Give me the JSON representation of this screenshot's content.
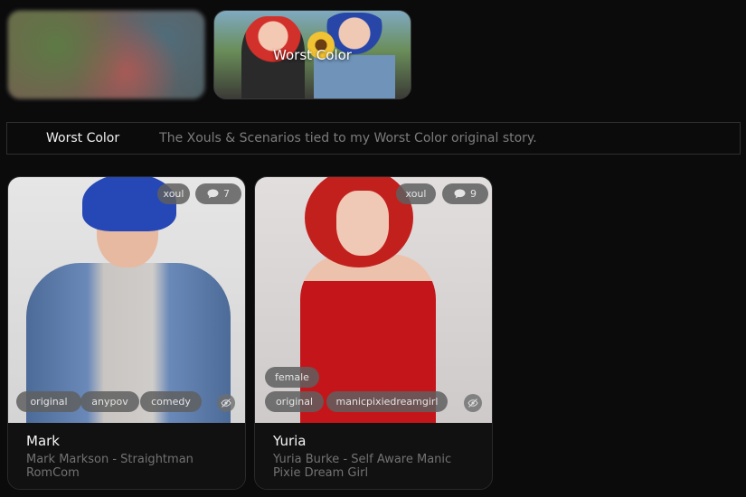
{
  "collections": [
    {
      "label": "",
      "active": false
    },
    {
      "label": "Worst Color",
      "active": true
    }
  ],
  "collection_bar": {
    "title": "Worst Color",
    "description": "The Xouls & Scenarios tied to my Worst Color original story."
  },
  "cards": [
    {
      "type_badge": "xoul",
      "comment_count": "7",
      "tags": [
        "original",
        "anypov",
        "comedy"
      ],
      "name": "Mark",
      "subtitle": "Mark Markson - Straightman RomCom"
    },
    {
      "type_badge": "xoul",
      "comment_count": "9",
      "tags_row1": [
        "female"
      ],
      "tags": [
        "original",
        "manicpixiedreamgirl"
      ],
      "name": "Yuria",
      "subtitle": "Yuria Burke - Self Aware Manic Pixie Dream Girl"
    }
  ]
}
